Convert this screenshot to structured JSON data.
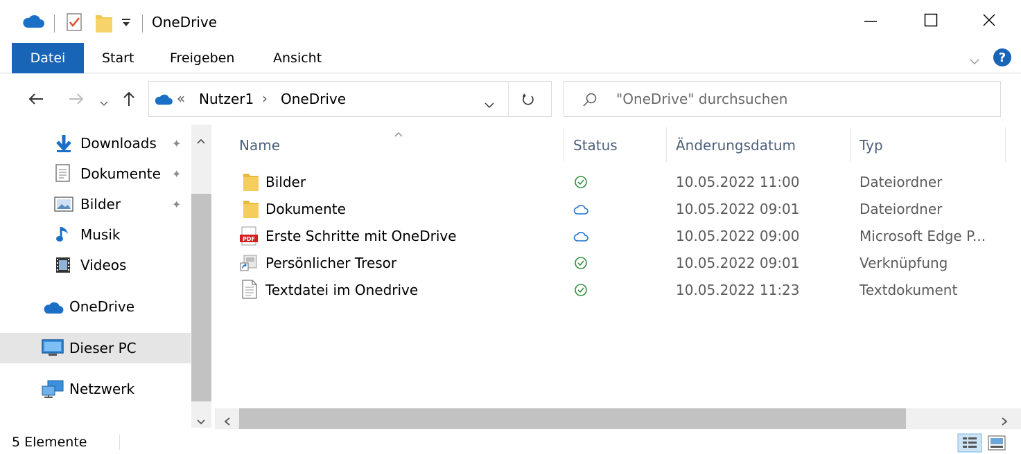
{
  "window": {
    "title": "OneDrive",
    "minimize_icon": "minimize-icon",
    "maximize_icon": "maximize-icon",
    "close_icon": "close-icon"
  },
  "quick_access_toolbar": {
    "icons": [
      "onedrive-cloud-icon",
      "properties-check-icon",
      "new-folder-icon",
      "customize-dropdown-icon"
    ]
  },
  "ribbon": {
    "tabs": [
      {
        "label": "Datei",
        "active": true
      },
      {
        "label": "Start"
      },
      {
        "label": "Freigeben"
      },
      {
        "label": "Ansicht"
      }
    ],
    "expand_icon": "chevron-down-icon",
    "help_icon": "help-icon"
  },
  "address": {
    "overflow": "«",
    "crumbs": [
      "Nutzer1",
      "OneDrive"
    ],
    "separator": "›",
    "search_placeholder": "\"OneDrive\" durchsuchen"
  },
  "nav": {
    "items": [
      {
        "label": "Downloads",
        "icon": "download-arrow-icon",
        "pinned": true
      },
      {
        "label": "Dokumente",
        "icon": "documents-icon",
        "pinned": true
      },
      {
        "label": "Bilder",
        "icon": "pictures-icon",
        "pinned": true
      },
      {
        "label": "Musik",
        "icon": "music-note-icon",
        "pinned": false
      },
      {
        "label": "Videos",
        "icon": "videos-icon",
        "pinned": false
      },
      {
        "label": "OneDrive",
        "icon": "onedrive-cloud-icon",
        "pinned": false
      },
      {
        "label": "Dieser PC",
        "icon": "computer-icon",
        "pinned": false,
        "selected": true
      },
      {
        "label": "Netzwerk",
        "icon": "network-icon",
        "pinned": false
      }
    ]
  },
  "files": {
    "columns": [
      "Name",
      "Status",
      "Änderungsdatum",
      "Typ"
    ],
    "rows": [
      {
        "name": "Bilder",
        "icon": "folder-icon",
        "status": "synced",
        "date": "10.05.2022 11:00",
        "type": "Dateiordner"
      },
      {
        "name": "Dokumente",
        "icon": "folder-icon",
        "status": "cloud",
        "date": "10.05.2022 09:01",
        "type": "Dateiordner"
      },
      {
        "name": "Erste Schritte mit OneDrive",
        "icon": "pdf-icon",
        "status": "cloud",
        "date": "10.05.2022 09:00",
        "type": "Microsoft Edge P..."
      },
      {
        "name": "Persönlicher Tresor",
        "icon": "shortcut-icon",
        "status": "synced",
        "date": "10.05.2022 09:01",
        "type": "Verknüpfung"
      },
      {
        "name": "Textdatei im Onedrive",
        "icon": "text-file-icon",
        "status": "synced",
        "date": "10.05.2022 11:23",
        "type": "Textdokument"
      }
    ]
  },
  "statusbar": {
    "count": "5 Elemente"
  },
  "colors": {
    "accent": "#1864b6",
    "synced": "#2f8f3a",
    "cloud": "#1c6fc7",
    "folder": "#f3c74f"
  }
}
